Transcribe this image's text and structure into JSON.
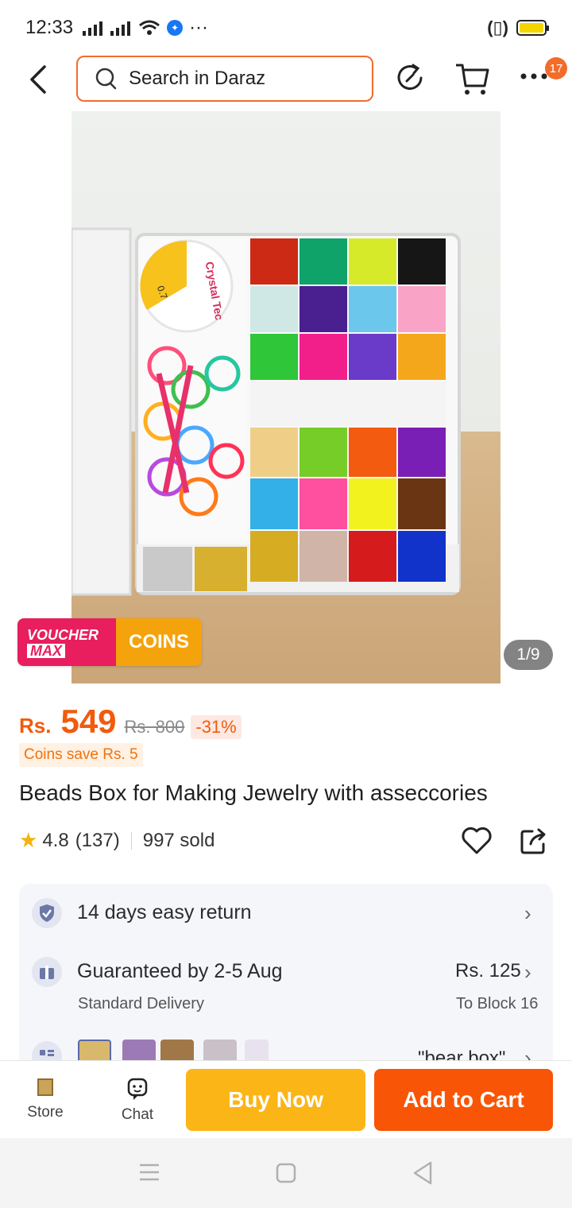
{
  "status_bar": {
    "time": "12:33",
    "more": "···"
  },
  "nav": {
    "search_placeholder": "Search in Daraz",
    "more_badge": "17",
    "icons": [
      "back-icon",
      "search-icon",
      "refresh-icon",
      "cart-icon",
      "more-icon"
    ]
  },
  "gallery": {
    "pager": "1/9",
    "voucher_label_1": "VOUCHER",
    "voucher_label_2": "MAX",
    "coins_label": "COINS",
    "box_label": "Crystal Tec",
    "spool_label": "0.7"
  },
  "price": {
    "currency": "Rs.",
    "current": "549",
    "original": "Rs. 800",
    "discount": "-31%",
    "coins_save": "Coins save Rs. 5"
  },
  "product": {
    "title": "Beads Box for Making Jewelry with asseccories",
    "rating": "4.8",
    "reviews": "(137)",
    "sold": "997 sold"
  },
  "services": {
    "return": "14 days easy return",
    "delivery_title": "Guaranteed by 2-5 Aug",
    "delivery_sub": "Standard Delivery",
    "delivery_price": "Rs. 125",
    "delivery_location": "To Block 16",
    "variant_label": "\"bear box\""
  },
  "bottom_bar": {
    "store": "Store",
    "chat": "Chat",
    "buy_now": "Buy Now",
    "add_to_cart": "Add to Cart"
  },
  "colors": {
    "accent": "#f85506",
    "buy_now": "#fbb516",
    "voucher_pink": "#e81e5e",
    "coins_orange": "#f5a30c"
  }
}
